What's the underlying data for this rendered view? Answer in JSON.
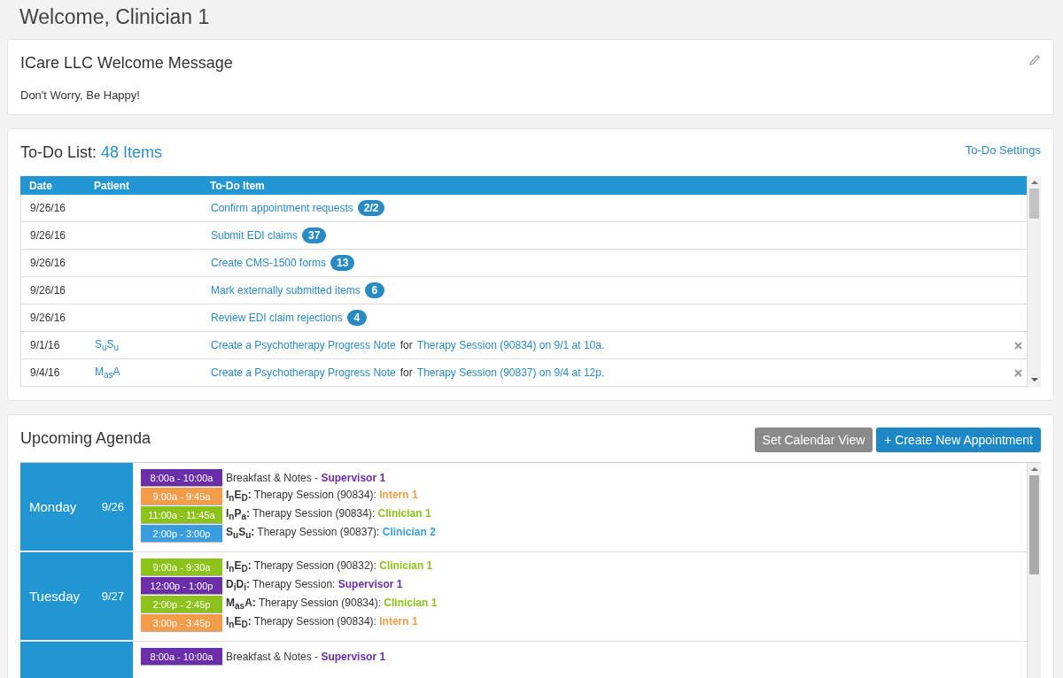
{
  "page_title": "Welcome, Clinician 1",
  "welcome_card": {
    "title": "ICare LLC Welcome Message",
    "message": "Don't Worry, Be Happy!"
  },
  "todo": {
    "title": "To-Do List:",
    "count": "48 Items",
    "settings_link": "To-Do Settings",
    "columns": [
      "Date",
      "Patient",
      "To-Do Item"
    ],
    "rows": [
      {
        "date": "9/26/16",
        "item": {
          "action": "Confirm appointment requests",
          "badge": "2/2"
        },
        "dismissible": false
      },
      {
        "date": "9/26/16",
        "item": {
          "action": "Submit EDI claims",
          "badge": "37"
        },
        "dismissible": false
      },
      {
        "date": "9/26/16",
        "item": {
          "action": "Create CMS-1500 forms",
          "badge": "13"
        },
        "dismissible": false
      },
      {
        "date": "9/26/16",
        "item": {
          "action": "Mark externally submitted items",
          "badge": "6"
        },
        "dismissible": false
      },
      {
        "date": "9/26/16",
        "item": {
          "action": "Review EDI claim rejections",
          "badge": "4"
        },
        "dismissible": false
      },
      {
        "date": "9/1/16",
        "patient": "S$_{u}$S$_{u}$",
        "item": {
          "action": "Create a Psychotherapy Progress Note",
          "connector": "for",
          "target": "Therapy Session (90834) on 9/1 at 10a."
        },
        "dismissible": true
      },
      {
        "date": "9/4/16",
        "patient": "M$_{as}$A",
        "item": {
          "action": "Create a Psychotherapy Progress Note",
          "connector": "for",
          "target": "Therapy Session (90837) on 9/4 at 12p."
        },
        "dismissible": true
      }
    ]
  },
  "agenda": {
    "title": "Upcoming Agenda",
    "buttons": [
      {
        "label": "Set Calendar View",
        "kind": "secondary"
      },
      {
        "label": "+ Create New Appointment",
        "kind": "primary"
      }
    ],
    "days": [
      {
        "day": "Monday",
        "date": "9/26",
        "events": [
          {
            "time": "8:00a - 10:00a",
            "color": "#6a2ea8",
            "description": "Breakfast & Notes - ",
            "provider": "Supervisor 1"
          },
          {
            "time": "9:00a - 9:45a",
            "color": "#f39c4a",
            "patient": "I$_{n}$E$_{D}$:",
            "description": " Therapy Session (90834): ",
            "provider": "Intern 1"
          },
          {
            "time": "11:00a - 11:45a",
            "color": "#8cc21a",
            "patient": "I$_{n}$P$_{a}$:",
            "description": " Therapy Session (90834): ",
            "provider": "Clinician 1"
          },
          {
            "time": "2:00p - 3:00p",
            "color": "#3a9de0",
            "patient": "S$_{u}$S$_{u}$:",
            "description": " Therapy Session (90837): ",
            "provider": "Clinician 2"
          }
        ]
      },
      {
        "day": "Tuesday",
        "date": "9/27",
        "events": [
          {
            "time": "9:00a - 9:30a",
            "color": "#8cc21a",
            "patient": "I$_{n}$E$_{D}$:",
            "description": " Therapy Session (90832): ",
            "provider": "Clinician 1"
          },
          {
            "time": "12:00p - 1:00p",
            "color": "#6a2ea8",
            "patient": "D$_{i}$D$_{i}$:",
            "description": " Therapy Session: ",
            "provider": "Supervisor 1"
          },
          {
            "time": "2:00p - 2:45p",
            "color": "#8cc21a",
            "patient": "M$_{as}$A:",
            "description": " Therapy Session (90834): ",
            "provider": "Clinician 1"
          },
          {
            "time": "3:00p - 3:45p",
            "color": "#f39c4a",
            "patient": "I$_{n}$E$_{D}$:",
            "description": " Therapy Session (90834): ",
            "provider": "Intern 1"
          }
        ]
      },
      {
        "events": [
          {
            "time": "8:00a - 10:00a",
            "color": "#6a2ea8",
            "description": "Breakfast & Notes - ",
            "provider": "Supervisor 1"
          }
        ]
      }
    ]
  }
}
